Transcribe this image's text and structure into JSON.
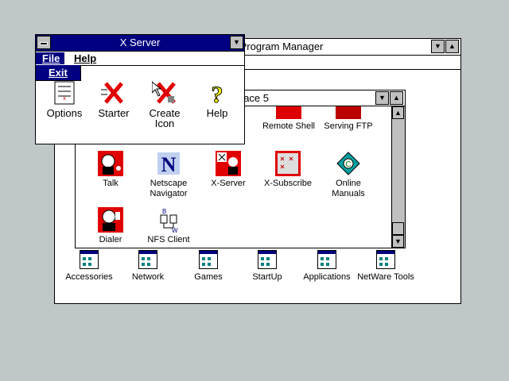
{
  "program_manager": {
    "title": "Program Manager"
  },
  "workplace": {
    "title": "Workplace 5"
  },
  "groups": [
    {
      "label": "Accessories"
    },
    {
      "label": "Network"
    },
    {
      "label": "Games"
    },
    {
      "label": "StartUp"
    },
    {
      "label": "Applications"
    },
    {
      "label": "NetWare Tools"
    }
  ],
  "workplace_icons": [
    {
      "label": "Remote Shell"
    },
    {
      "label": "Serving FTP"
    },
    {
      "label": "Talk"
    },
    {
      "label": "Netscape Navigator"
    },
    {
      "label": "X-Server"
    },
    {
      "label": "X-Subscribe"
    },
    {
      "label": "Online Manuals"
    },
    {
      "label": "Dialer"
    },
    {
      "label": "NFS Client"
    }
  ],
  "xserver": {
    "title": "X Server",
    "menu": {
      "file": "File",
      "help": "Help"
    },
    "file_menu_items": [
      {
        "label": "Exit"
      }
    ],
    "icons": [
      {
        "label": "Options"
      },
      {
        "label": "Starter"
      },
      {
        "label": "Create Icon"
      },
      {
        "label": "Help"
      }
    ]
  },
  "colors": {
    "desktop": "#c0c7c8",
    "active_title": "#000080",
    "highlight": "#000080"
  }
}
